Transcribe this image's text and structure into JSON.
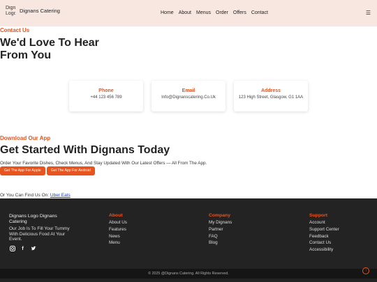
{
  "header": {
    "logo_alt": "Dignans Logo",
    "brand": "Dignans Catering",
    "nav": [
      "Home",
      "About",
      "Menus",
      "Order",
      "Offers",
      "Contact"
    ],
    "menu_icon": "☰"
  },
  "contact": {
    "eyebrow": "Contact Us",
    "heading": "We'd Love To Hear From You",
    "cards": [
      {
        "title": "Phone",
        "value": "+44 123 456 789"
      },
      {
        "title": "Email",
        "value": "Info@Dignanscatering.Co.Uk"
      },
      {
        "title": "Address",
        "value": "123 High Street, Glasgow, G1 1AA"
      }
    ]
  },
  "app": {
    "eyebrow": "Download Our App",
    "heading": "Get Started With Dignans Today",
    "description": "Order Your Favorite Dishes, Check Menus, And Stay Updated With Our Latest Offers — All From The App.",
    "apple_button": "Get The App For Apple",
    "android_button": "Get The App For Android",
    "find_prefix": "Or You Can Find Us On:",
    "find_link": "Uber Eats"
  },
  "footer": {
    "brand": "Dignans Logo   Dignans Catering",
    "tagline": "Our Job Is To Fill Your Tummy With Delicious Food At Your Event.",
    "columns": [
      {
        "title": "About",
        "items": [
          "About Us",
          "Features",
          "News",
          "Menu"
        ]
      },
      {
        "title": "Company",
        "items": [
          "My Dignans",
          "Partner",
          "FAQ",
          "Blog"
        ]
      },
      {
        "title": "Support",
        "items": [
          "Account",
          "Support Center",
          "Feedback",
          "Contact Us",
          "Accessibility"
        ]
      }
    ],
    "copyright": "© 2025 @Dignans Catering. All Rights Reserved."
  },
  "colors": {
    "accent": "#e8541e",
    "header_bg": "#f8e7e1",
    "footer_bg": "#232323"
  }
}
